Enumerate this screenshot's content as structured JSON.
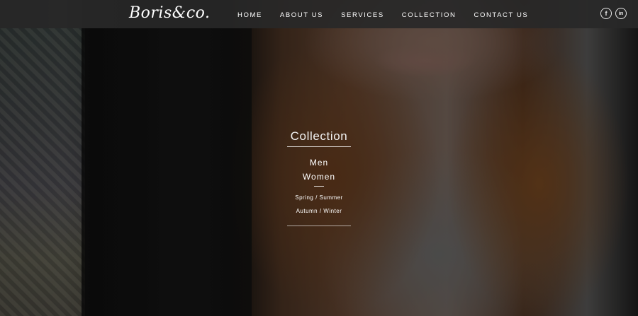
{
  "brand": {
    "logo_text": "Boris&co."
  },
  "nav": {
    "items": [
      {
        "label": "HOME"
      },
      {
        "label": "ABOUT US"
      },
      {
        "label": "SERVICES"
      },
      {
        "label": "COLLECTION"
      },
      {
        "label": "CONTACT US"
      }
    ]
  },
  "social": {
    "facebook_glyph": "f",
    "linkedin_glyph": "in",
    "icons": [
      "facebook-icon",
      "linkedin-icon"
    ]
  },
  "collection": {
    "title": "Collection",
    "main_items": [
      {
        "label": "Men"
      },
      {
        "label": "Women"
      }
    ],
    "sub_items": [
      {
        "label": "Spring / Summer"
      },
      {
        "label": "Autumn / Winter"
      }
    ]
  },
  "colors": {
    "navbar_bg": "#282828",
    "text": "#ffffff"
  }
}
